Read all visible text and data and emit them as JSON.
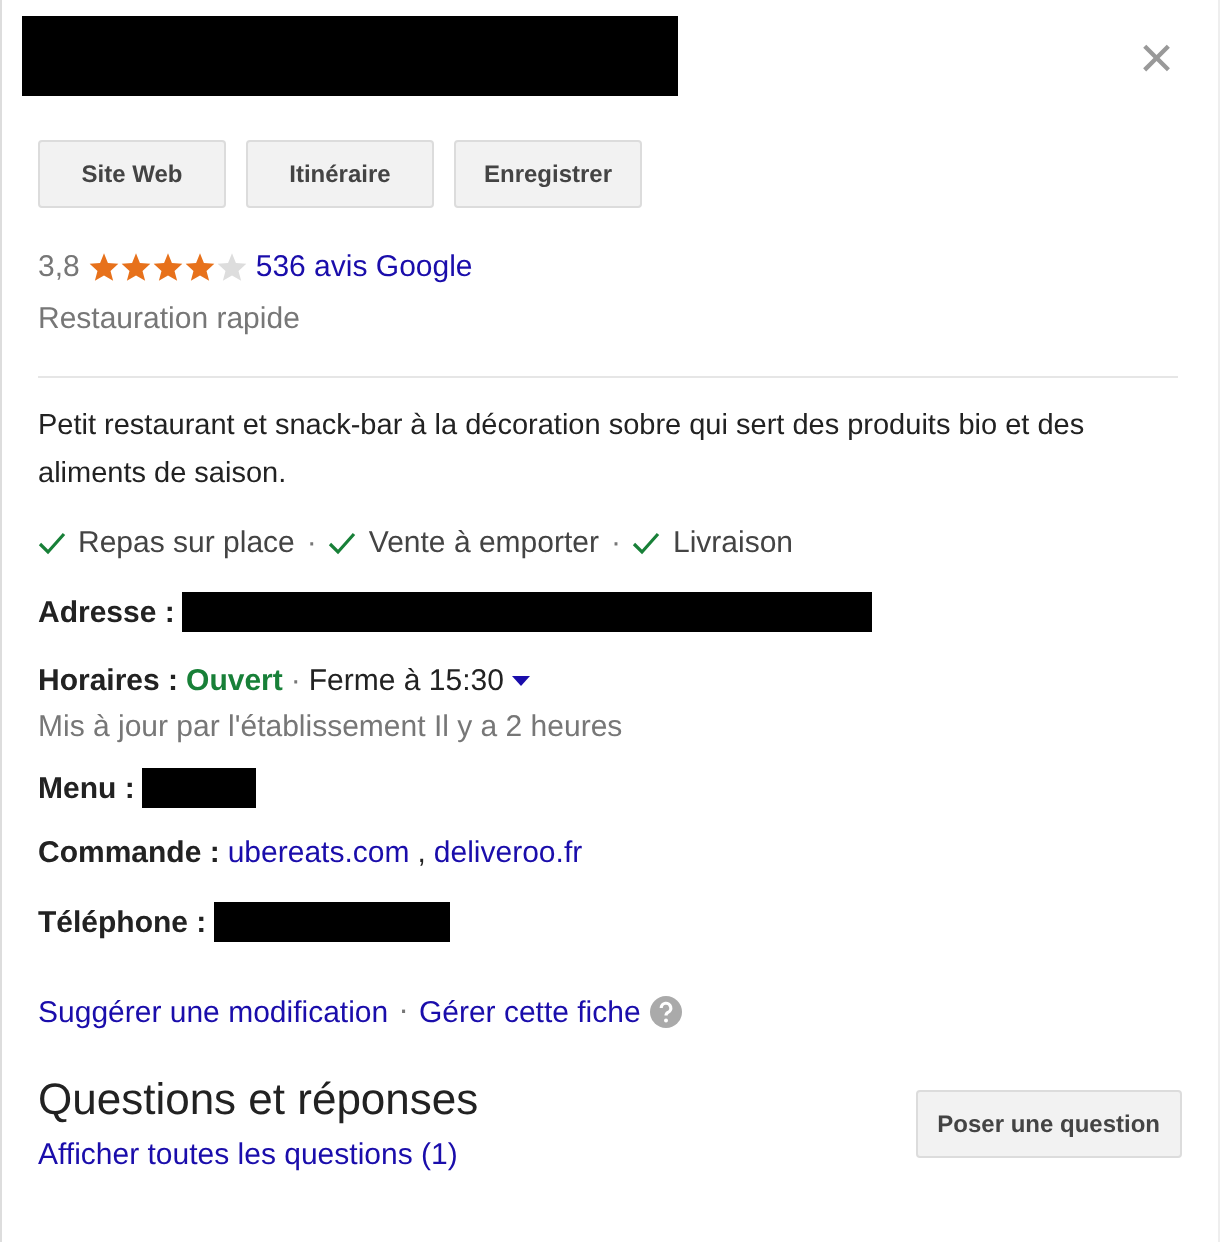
{
  "header": {
    "title_redacted": true,
    "close": "×"
  },
  "actions": [
    {
      "label": "Site Web"
    },
    {
      "label": "Itinéraire"
    },
    {
      "label": "Enregistrer"
    }
  ],
  "rating": {
    "score": "3,8",
    "stars": 4,
    "reviews": "536 avis Google"
  },
  "category": "Restauration rapide",
  "description": "Petit restaurant et snack-bar à la décoration sobre qui sert des produits bio et des aliments de saison.",
  "separator": "·",
  "link_separator": ",",
  "attributes": [
    {
      "label": "Repas sur place",
      "available": true
    },
    {
      "label": "Vente à emporter",
      "available": true
    },
    {
      "label": "Livraison",
      "available": true
    }
  ],
  "details": [
    {
      "kind": "redacted",
      "label": "Adresse :"
    },
    {
      "kind": "hours",
      "label": "Horaires :",
      "status": "Ouvert",
      "open": true,
      "closes": "Ferme à 15:30",
      "note": "Mis à jour par l'établissement Il y a 2 heures"
    },
    {
      "kind": "redacted",
      "label": "Menu :"
    },
    {
      "kind": "links",
      "label": "Commande :",
      "links": [
        "ubereats.com",
        "deliveroo.fr"
      ]
    },
    {
      "kind": "redacted",
      "label": "Téléphone :"
    }
  ],
  "footer_links": [
    "Suggérer une modification",
    "Gérer cette fiche"
  ],
  "qa": {
    "title": "Questions et réponses",
    "link": "Afficher toutes les questions (1)",
    "button": "Poser une question"
  }
}
